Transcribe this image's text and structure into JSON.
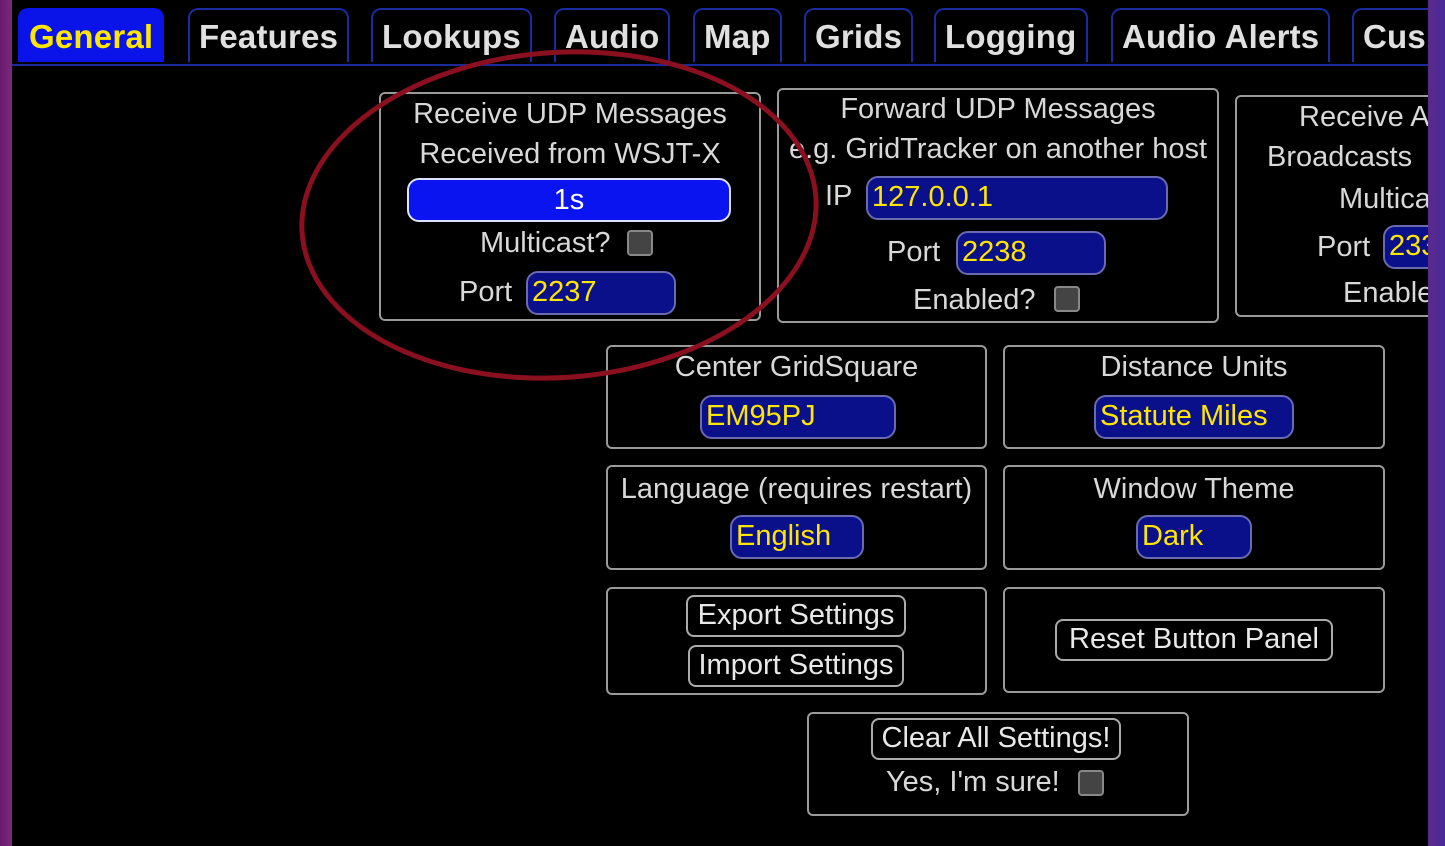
{
  "tabs": [
    {
      "label": "General"
    },
    {
      "label": "Features"
    },
    {
      "label": "Lookups"
    },
    {
      "label": "Audio"
    },
    {
      "label": "Map"
    },
    {
      "label": "Grids"
    },
    {
      "label": "Logging"
    },
    {
      "label": "Audio Alerts"
    },
    {
      "label": "Cus"
    }
  ],
  "receive_udp": {
    "title1": "Receive UDP Messages",
    "title2": "Received from WSJT-X",
    "status": "1s",
    "multicast_label": "Multicast?",
    "port_label": "Port",
    "port_value": "2237"
  },
  "forward_udp": {
    "title1": "Forward UDP Messages",
    "title2": "e.g. GridTracker on another host",
    "ip_label": "IP",
    "ip_value": "127.0.0.1",
    "port_label": "Port",
    "port_value": "2238",
    "enabled_label": "Enabled?"
  },
  "receive_broadcasts": {
    "title1": "Receive A",
    "title2": "Broadcasts",
    "multicast_label": "Multica",
    "port_label": "Port",
    "port_value": "233",
    "enabled_label": "Enable"
  },
  "center_grid": {
    "title": "Center GridSquare",
    "value": "EM95PJ"
  },
  "distance_units": {
    "title": "Distance Units",
    "value": "Statute Miles"
  },
  "language": {
    "title": "Language (requires restart)",
    "value": "English"
  },
  "window_theme": {
    "title": "Window Theme",
    "value": "Dark"
  },
  "settings_io": {
    "export": "Export Settings",
    "import": "Import Settings"
  },
  "reset_panel": {
    "label": "Reset Button Panel"
  },
  "clear_all": {
    "button": "Clear All Settings!",
    "confirm": "Yes, I'm sure!"
  },
  "colors": {
    "active_tab": "#0a14e8",
    "accent_text": "#ffe600",
    "field_bg": "#0a0f8a",
    "annotation": "#8a1020"
  }
}
